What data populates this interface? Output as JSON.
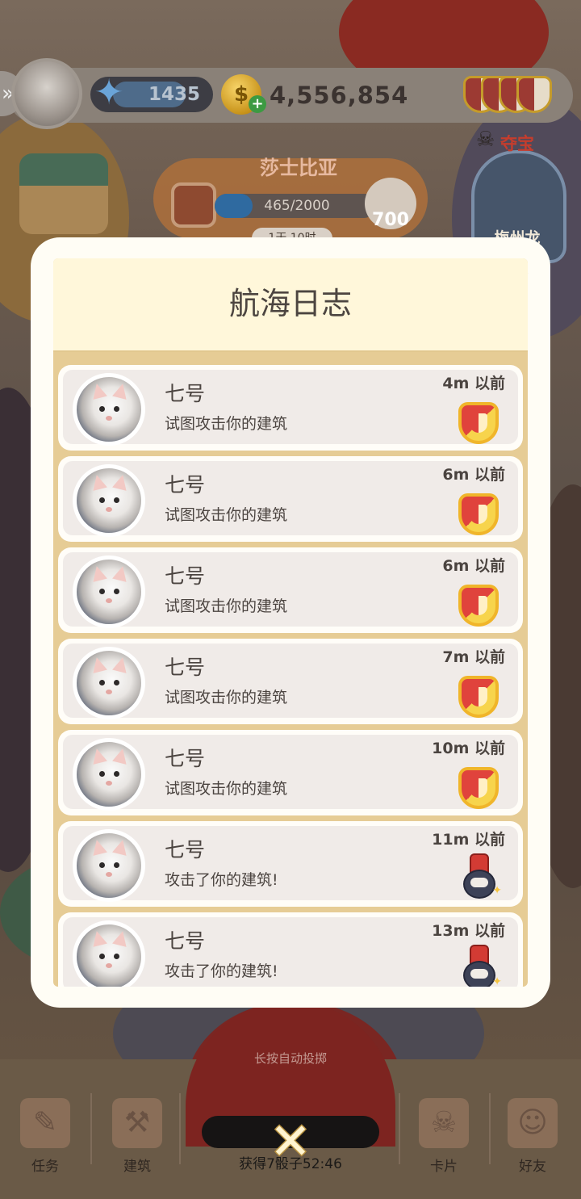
{
  "hud": {
    "level": "1435",
    "coins": "4,556,854",
    "coin_plus": "+",
    "back_icon": "double-chevron-right-icon"
  },
  "event": {
    "title": "莎士比亚",
    "progress_text": "465/2000",
    "progress": 0.2325,
    "dice_count": "700",
    "timer": "1天 10时"
  },
  "treasure": {
    "label": "夺宝",
    "rival_name": "梅州龙"
  },
  "modal": {
    "title": "航海日志",
    "entries": [
      {
        "name": "七号",
        "message": "试图攻击你的建筑",
        "time": "4m 以前",
        "icon": "shield-icon"
      },
      {
        "name": "七号",
        "message": "试图攻击你的建筑",
        "time": "6m 以前",
        "icon": "shield-icon"
      },
      {
        "name": "七号",
        "message": "试图攻击你的建筑",
        "time": "6m 以前",
        "icon": "shield-icon"
      },
      {
        "name": "七号",
        "message": "试图攻击你的建筑",
        "time": "7m 以前",
        "icon": "shield-icon"
      },
      {
        "name": "七号",
        "message": "试图攻击你的建筑",
        "time": "10m 以前",
        "icon": "shield-icon"
      },
      {
        "name": "七号",
        "message": "攻击了你的建筑!",
        "time": "11m 以前",
        "icon": "cannon-icon"
      },
      {
        "name": "七号",
        "message": "攻击了你的建筑!",
        "time": "13m 以前",
        "icon": "cannon-icon"
      }
    ]
  },
  "bottom": {
    "roll_hint": "长按自动投掷",
    "dice_timer": "获得7骰子52:46",
    "nav": [
      {
        "label": "任务",
        "icon": "task-icon"
      },
      {
        "label": "建筑",
        "icon": "building-icon"
      },
      {
        "label": "卡片",
        "icon": "cards-icon"
      },
      {
        "label": "好友",
        "icon": "friends-icon"
      }
    ]
  },
  "close_icon": "close-icon"
}
